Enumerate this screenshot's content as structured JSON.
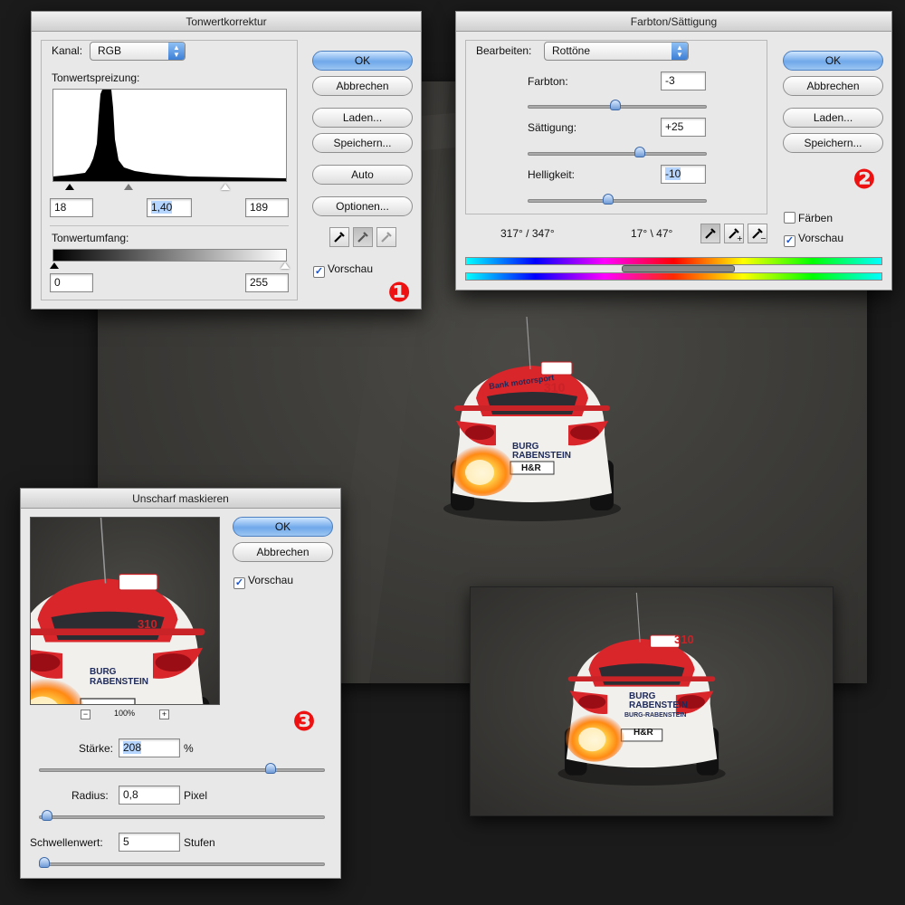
{
  "levels": {
    "title": "Tonwertkorrektur",
    "channel_label": "Kanal:",
    "channel_value": "RGB",
    "input_levels_label": "Tonwertspreizung:",
    "input_black": "18",
    "input_gamma": "1,40",
    "input_white": "189",
    "output_levels_label": "Tonwertumfang:",
    "output_black": "0",
    "output_white": "255",
    "buttons": {
      "ok": "OK",
      "cancel": "Abbrechen",
      "load": "Laden...",
      "save": "Speichern...",
      "auto": "Auto",
      "options": "Optionen..."
    },
    "preview_label": "Vorschau",
    "preview_checked": true,
    "badge": "❶"
  },
  "huesat": {
    "title": "Farbton/Sättigung",
    "edit_label": "Bearbeiten:",
    "edit_value": "Rottöne",
    "hue_label": "Farbton:",
    "hue_value": "-3",
    "hue_level": -3,
    "saturation_label": "Sättigung:",
    "saturation_value": "+25",
    "saturation_level": 25,
    "lightness_label": "Helligkeit:",
    "lightness_value": "-10",
    "lightness_level": -10,
    "range_left": "317° / 347°",
    "range_right": "17° \\ 47°",
    "buttons": {
      "ok": "OK",
      "cancel": "Abbrechen",
      "load": "Laden...",
      "save": "Speichern..."
    },
    "colorize_label": "Färben",
    "colorize_checked": false,
    "preview_label": "Vorschau",
    "preview_checked": true,
    "badge": "❷"
  },
  "unsharp": {
    "title": "Unscharf maskieren",
    "zoom_minus": "−",
    "zoom_value": "100%",
    "zoom_plus": "+",
    "amount_label": "Stärke:",
    "amount_value": "208",
    "amount_unit": "%",
    "amount_fraction": 0.81,
    "radius_label": "Radius:",
    "radius_value": "0,8",
    "radius_unit": "Pixel",
    "radius_fraction": 0.03,
    "threshold_label": "Schwellenwert:",
    "threshold_value": "5",
    "threshold_unit": "Stufen",
    "threshold_fraction": 0.02,
    "buttons": {
      "ok": "OK",
      "cancel": "Abbrechen"
    },
    "preview_label": "Vorschau",
    "preview_checked": true,
    "badge": "❸"
  },
  "photo": {
    "car_number": "310",
    "sponsor_top": "Bank motorsport",
    "sponsor_brand_1": "BURG",
    "sponsor_brand_2": "RABENSTEIN",
    "sponsor_small": "BURG-RABENSTEIN",
    "plate": "H&R",
    "colors": {
      "asphalt": "#3f3e3b",
      "car_red": "#d8262b",
      "car_white": "#f1f0ec",
      "flame": "#ffb22e"
    }
  }
}
